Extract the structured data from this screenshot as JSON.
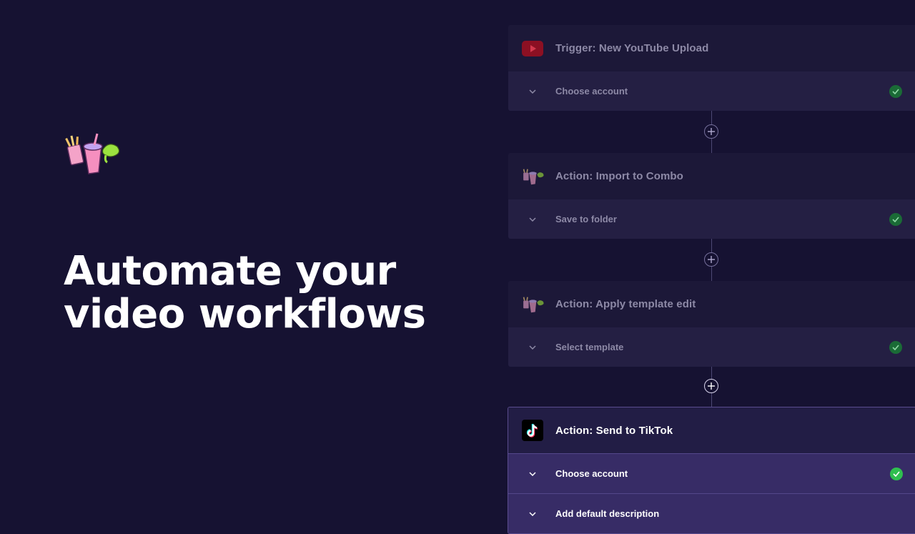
{
  "hero": {
    "headline_line1": "Automate your",
    "headline_line2": "video workflows",
    "logo_icon": "combo-drinks-logo-icon"
  },
  "workflow": {
    "steps": [
      {
        "title": "Trigger: New YouTube Upload",
        "icon": "youtube-icon",
        "rows": [
          {
            "label": "Choose account",
            "status": "complete"
          }
        ]
      },
      {
        "title": "Action: Import to Combo",
        "icon": "combo-logo-icon",
        "rows": [
          {
            "label": "Save to folder",
            "status": "complete"
          }
        ]
      },
      {
        "title": "Action: Apply template edit",
        "icon": "combo-logo-icon",
        "rows": [
          {
            "label": "Select template",
            "status": "complete"
          }
        ]
      },
      {
        "title": "Action: Send to TikTok",
        "icon": "tiktok-icon",
        "active": true,
        "rows": [
          {
            "label": "Choose account",
            "status": "complete"
          },
          {
            "label": "Add default description"
          }
        ]
      }
    ]
  },
  "colors": {
    "background": "#161232",
    "card_header": "#1c1838",
    "card_row": "#241f43",
    "active_row": "#372c66",
    "check_muted": "#1a6b36",
    "check_active": "#2fbf4f",
    "youtube_red": "#c4112e"
  }
}
